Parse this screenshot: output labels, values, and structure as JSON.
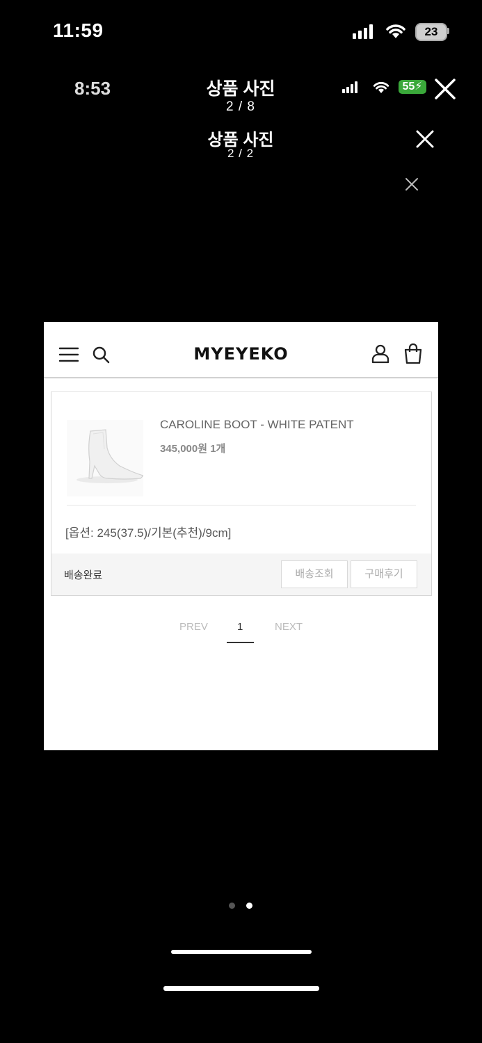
{
  "status_bar": {
    "time": "11:59",
    "battery": "23"
  },
  "viewer_layers": [
    {
      "time": "8:53",
      "battery": "55",
      "title": "상품 사진",
      "counter": "2 / 8"
    },
    {
      "title": "상품 사진",
      "counter": "2 / 2"
    }
  ],
  "shop": {
    "logo": "MYEYEKO",
    "order": {
      "product_name": "CAROLINE BOOT - WHITE PATENT",
      "price": "345,000원 1개",
      "option": "[옵션: 245(37.5)/기본(추천)/9cm]",
      "status": "배송완료",
      "track_button": "배송조회",
      "review_button": "구매후기"
    },
    "pagination": {
      "prev": "PREV",
      "current": "1",
      "next": "NEXT"
    }
  },
  "page_dots": {
    "count": 2,
    "active_index": 1
  }
}
